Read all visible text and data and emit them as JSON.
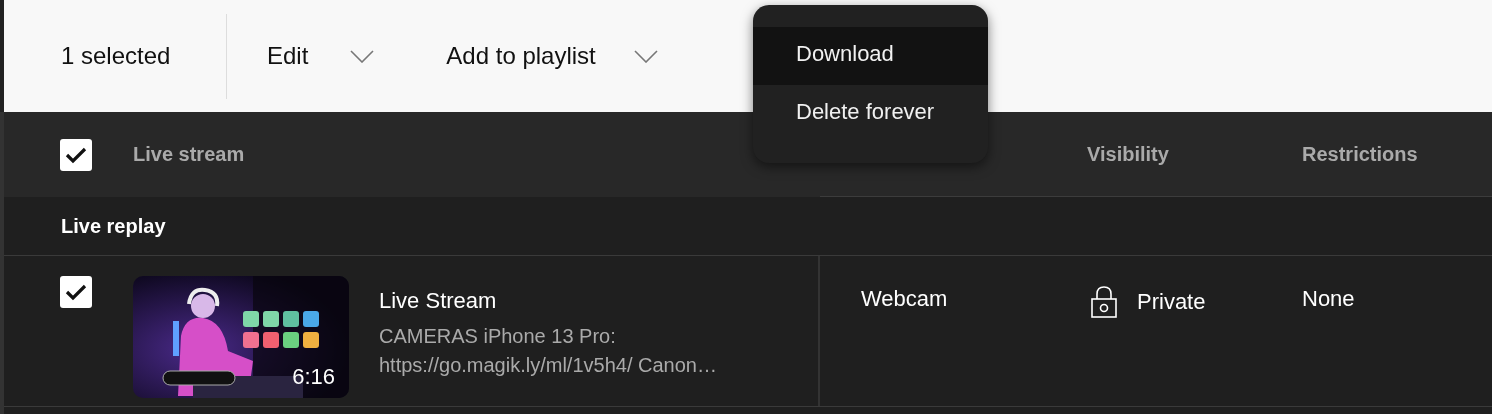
{
  "toolbar": {
    "selection": "1 selected",
    "actions": [
      {
        "label": "Edit"
      },
      {
        "label": "Add to playlist"
      }
    ]
  },
  "menu": {
    "items": [
      {
        "label": "Download",
        "selected": true
      },
      {
        "label": "Delete forever",
        "selected": false
      }
    ]
  },
  "table": {
    "select_all_checked": true,
    "columns": [
      "Live stream",
      "Visibility",
      "Restrictions"
    ],
    "groups": [
      {
        "title": "Live replay",
        "rows": [
          {
            "checked": true,
            "title": "Live Stream",
            "description": "CAMERAS iPhone 13 Pro: https://go.magik.ly/ml/1v5h4/ Canon…",
            "duration": "6:16",
            "type": "Webcam",
            "visibility": "Private",
            "restrictions": "None"
          }
        ]
      }
    ]
  }
}
